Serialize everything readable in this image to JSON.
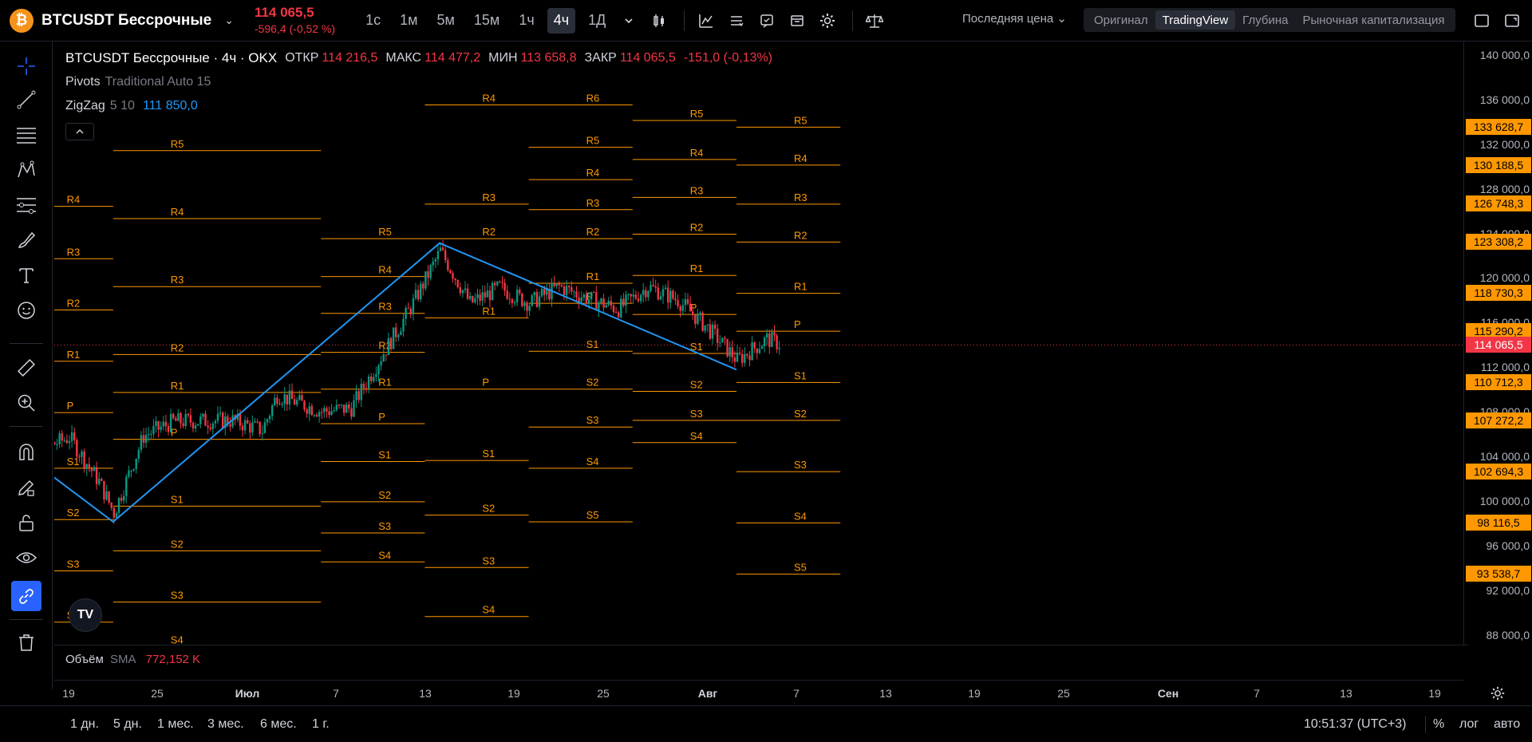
{
  "header": {
    "symbol_icon": "bitcoin-icon",
    "symbol_name": "BTCUSDT Бессрочные",
    "last_price": "114 065,5",
    "change": "-596,4 (-0,52 %)",
    "timeframes": [
      "1с",
      "1м",
      "5м",
      "15м",
      "1ч",
      "4ч",
      "1Д"
    ],
    "active_timeframe": "4ч",
    "price_source": "Последняя цена ⌄",
    "views": [
      "Оригинал",
      "TradingView",
      "Глубина",
      "Рыночная капитализация"
    ],
    "active_view": "TradingView"
  },
  "legend": {
    "title": "BTCUSDT Бессрочные · 4ч · OKX",
    "open_label": "ОТКР",
    "open": "114 216,5",
    "high_label": "МАКС",
    "high": "114 477,2",
    "low_label": "МИН",
    "low": "113 658,8",
    "close_label": "ЗАКР",
    "close": "114 065,5",
    "change": "-151,0 (-0,13%)",
    "pivots_name": "Pivots",
    "pivots_params": "Traditional Auto 15",
    "zigzag_name": "ZigZag",
    "zigzag_params": "5 10",
    "zigzag_value": "111 850,0"
  },
  "volume": {
    "name": "Объём",
    "params": "SMA",
    "value": "772,152 K"
  },
  "price_scale": {
    "ticks": [
      "140 000,0",
      "136 000,0",
      "132 000,0",
      "128 000,0",
      "124 000,0",
      "120 000,0",
      "116 000,0",
      "112 000,0",
      "108 000,0",
      "104 000,0",
      "100 000,0",
      "96 000,0",
      "92 000,0",
      "88 000,0"
    ],
    "tags": [
      "133 628,7",
      "130 188,5",
      "126 748,3",
      "123 308,2",
      "118 730,3",
      "115 290,2",
      "110 712,3",
      "107 272,2",
      "102 694,3",
      "98 116,5",
      "93 538,7"
    ],
    "current": "114 065,5"
  },
  "time_scale": [
    "19",
    "25",
    "Июл",
    "7",
    "13",
    "19",
    "25",
    "Авг",
    "7",
    "13",
    "19",
    "25",
    "Сен",
    "7",
    "13",
    "19"
  ],
  "bottom": {
    "ranges": [
      "1 дн.",
      "5 дн.",
      "1 мес.",
      "3 мес.",
      "6 мес.",
      "1 г."
    ],
    "clock": "10:51:37 (UTC+3)",
    "percent": "%",
    "log": "лог",
    "auto": "авто"
  },
  "pivot_labels": [
    "R5",
    "R4",
    "R3",
    "R2",
    "R1",
    "P",
    "S1",
    "S2",
    "S3",
    "S4",
    "S5"
  ],
  "colors": {
    "up": "#089981",
    "down": "#f23645",
    "pivot": "#ff9800",
    "zigzag": "#2196f3",
    "accent": "#2962ff"
  },
  "chart_data": {
    "type": "candlestick",
    "ylim": [
      87000,
      141000
    ],
    "pivot_periods": [
      {
        "x0": "2025-06-15",
        "x1": "2025-06-22",
        "levels": [
          126500,
          121800,
          117200,
          112600,
          108000,
          103000,
          98400,
          93800,
          89200
        ]
      },
      {
        "x0": "2025-06-22",
        "x1": "2025-07-06",
        "levels": [
          131500,
          125400,
          119300,
          113200,
          109800,
          105600,
          99600,
          95600,
          91000,
          87000
        ]
      },
      {
        "x0": "2025-07-06",
        "x1": "2025-07-13",
        "levels": [
          123600,
          120200,
          116900,
          113400,
          110100,
          107000,
          103600,
          100000,
          97200,
          94600
        ]
      },
      {
        "x0": "2025-07-13",
        "x1": "2025-07-20",
        "levels": [
          135600,
          126700,
          123600,
          116500,
          110100,
          103700,
          98800,
          94100,
          89700
        ]
      },
      {
        "x0": "2025-07-20",
        "x1": "2025-07-27",
        "levels": [
          135600,
          131800,
          128900,
          126200,
          123600,
          119600,
          117800,
          113500,
          110100,
          106700,
          103000,
          98200
        ]
      },
      {
        "x0": "2025-07-27",
        "x1": "2025-08-03",
        "levels": [
          134200,
          130700,
          127300,
          124000,
          120300,
          116800,
          113300,
          109900,
          107300,
          105300
        ]
      },
      {
        "x0": "2025-08-03",
        "x1": "2025-08-10",
        "levels": [
          133600,
          130200,
          126700,
          123300,
          118700,
          115300,
          110700,
          107300,
          102700,
          98100,
          93500
        ]
      }
    ],
    "zigzag": [
      {
        "x": "2025-06-15",
        "y": 105200
      },
      {
        "x": "2025-06-22",
        "y": 98200
      },
      {
        "x": "2025-07-14",
        "y": 123200
      },
      {
        "x": "2025-08-03",
        "y": 111850
      }
    ]
  }
}
